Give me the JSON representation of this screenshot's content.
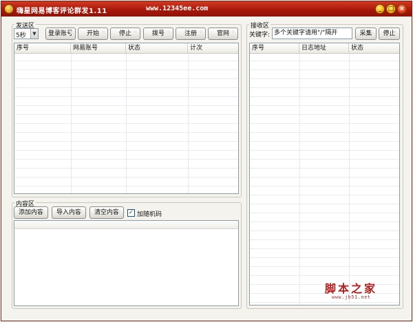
{
  "window": {
    "title": "嗨星网易博客评论群发1.11",
    "url": "www.12345ee.com",
    "controls": {
      "minimize": "_",
      "maximize": "□",
      "close": "×"
    }
  },
  "send_area": {
    "label": "发送区",
    "interval": {
      "value": "5秒"
    },
    "buttons": {
      "login": "登录账号",
      "start": "开始",
      "stop": "停止",
      "dial": "拨号",
      "register": "注册",
      "official": "官网"
    },
    "table": {
      "columns": [
        "序号",
        "网易账号",
        "状态",
        "计次"
      ],
      "rows": []
    }
  },
  "content_area": {
    "label": "内容区",
    "buttons": {
      "add": "添加内容",
      "import": "导入内容",
      "clear": "清空内容"
    },
    "random_code": {
      "label": "加随机码",
      "checked": true
    }
  },
  "receive_area": {
    "label": "接收区",
    "keyword_label": "关键字:",
    "keyword_value": "多个关键字请用\"/\"隔开",
    "buttons": {
      "collect": "采集",
      "stop": "停止"
    },
    "table": {
      "columns": [
        "序号",
        "日志地址",
        "状态"
      ],
      "rows": []
    }
  },
  "watermark": {
    "main": "脚本之家",
    "url": "www.jb51.net"
  }
}
